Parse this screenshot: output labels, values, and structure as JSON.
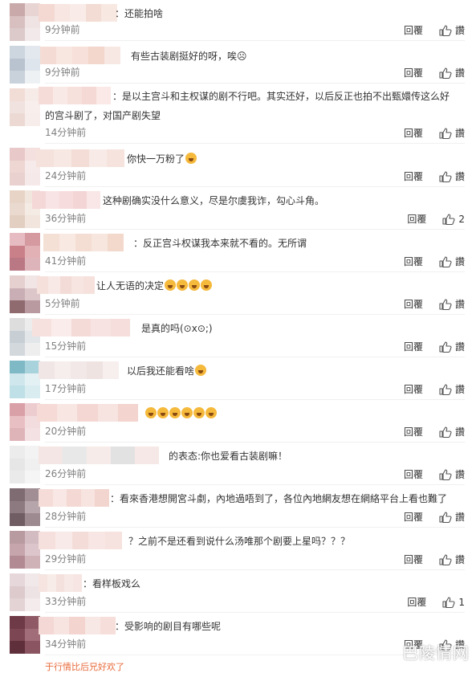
{
  "labels": {
    "reply": "回覆",
    "praise": "讚"
  },
  "comments": [
    {
      "text": "：还能拍啥",
      "time": "9分钟前",
      "likes": ""
    },
    {
      "text": "有些古装剧挺好的呀，唉☹",
      "time": "9分钟前",
      "likes": ""
    },
    {
      "text": "：是以主宫斗和主权谋的剧不行吧。其实还好，以后反正也拍不出甄嬛传这么好",
      "text2": "的宫斗剧了，对国产剧失望",
      "time": "14分钟前",
      "likes": ""
    },
    {
      "text": "你快一万粉了",
      "time": "24分钟前",
      "likes": ""
    },
    {
      "text": "这种剧确实没什么意义，尽是尔虞我诈，勾心斗角。",
      "time": "36分钟前",
      "likes": "2",
      "reply": "回覆"
    },
    {
      "text": "：反正宫斗权谋我本来就不看的。无所谓",
      "time": "41分钟前",
      "likes": ""
    },
    {
      "text": "让人无语的决定",
      "time": "5分钟前",
      "likes": ""
    },
    {
      "text": "是真的吗(⊙x⊙;)",
      "time": "15分钟前",
      "likes": ""
    },
    {
      "text": "以后我还能看啥",
      "time": "17分钟前",
      "likes": ""
    },
    {
      "text": "",
      "time": "20分钟前",
      "likes": ""
    },
    {
      "text": "的表态:你也爱看古装剧嘛！",
      "time": "26分钟前",
      "likes": ""
    },
    {
      "text": "：看來香港想開宮斗劇，內地過唔到了，各位內地網友想在網絡平台上看也難了",
      "time": "28分钟前",
      "likes": ""
    },
    {
      "text": "？之前不是还看到说什么汤唯那个剧要上星吗？？？",
      "time": "29分钟前",
      "likes": ""
    },
    {
      "text": "：看样板戏么",
      "time": "33分钟前",
      "likes": "1",
      "reply": "回覆"
    },
    {
      "text": "：受影响的剧目有哪些呢",
      "time": "34分钟前",
      "likes": ""
    }
  ],
  "partial_bottom_text": "于行情比后兄好欢了",
  "watermark": "巴陵情网"
}
